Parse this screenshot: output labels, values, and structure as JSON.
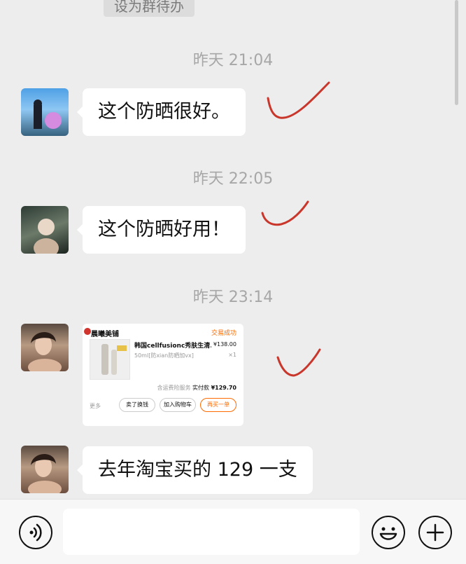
{
  "top_pill": "设为群待办",
  "messages": [
    {
      "time": "昨天 21:04",
      "text": "这个防晒很好。"
    },
    {
      "time": "昨天 22:05",
      "text": "这个防晒好用！"
    },
    {
      "time": "昨天 23:14"
    },
    {
      "text": "去年淘宝买的 129 一支"
    }
  ],
  "order": {
    "shop": "晨曦美铺",
    "status": "交易成功",
    "title": "韩国cellfusionc秀肤生清...",
    "price": "¥138.00",
    "spec": "50ml[防xian防晒加vx]",
    "qty": "×1",
    "total_prefix": "含运费险服务 ",
    "total_label": "实付款",
    "total_value": "¥129.70",
    "more": "更多",
    "btn_sell": "卖了换钱",
    "btn_cart": "加入购物车",
    "btn_rebuy": "再买一单"
  },
  "colors": {
    "accent": "#ff6a00",
    "check_mark": "#c9372c"
  },
  "icons": {
    "voice": "voice-icon",
    "emoji": "emoji-icon",
    "plus": "plus-icon"
  }
}
